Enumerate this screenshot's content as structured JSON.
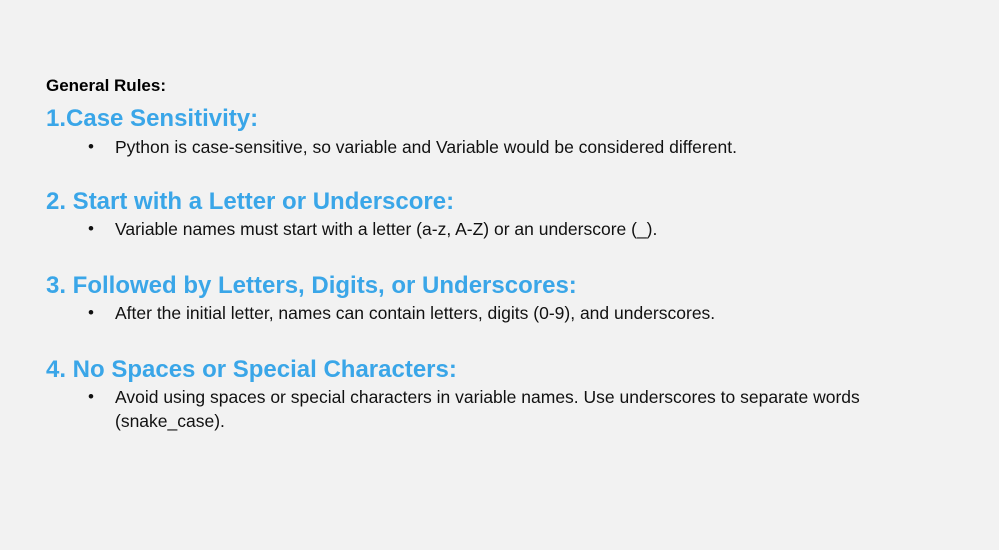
{
  "general_title": "General Rules:",
  "colors": {
    "background": "#f2f2f2",
    "heading": "#3aa6e8",
    "body_text": "#111111"
  },
  "rules": [
    {
      "heading": "1.Case Sensitivity:",
      "bullets": [
        "Python is case-sensitive, so variable and Variable would be considered different."
      ]
    },
    {
      "heading": "2. Start with a Letter or Underscore:",
      "bullets": [
        "Variable names must start with a letter (a-z, A-Z) or an underscore (_)."
      ]
    },
    {
      "heading": "3. Followed by Letters, Digits, or Underscores:",
      "bullets": [
        "After the initial letter, names can contain letters, digits (0-9), and underscores."
      ]
    },
    {
      "heading": "4. No Spaces or Special Characters:",
      "bullets": [
        "Avoid using spaces or special characters in variable names. Use underscores to separate words (snake_case)."
      ]
    }
  ]
}
